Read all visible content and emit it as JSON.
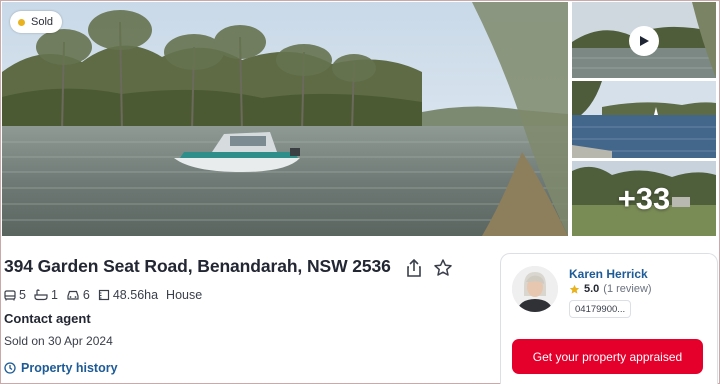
{
  "listing": {
    "status_badge": "Sold",
    "address": "394 Garden Seat Road, Benandarah, NSW 2536",
    "features": {
      "bedrooms": "5",
      "bathrooms": "1",
      "parking": "6",
      "land_size": "48.56ha",
      "property_type": "House"
    },
    "price": "Contact agent",
    "sold_date": "Sold on 30 Apr 2024",
    "property_history_label": "Property history"
  },
  "gallery": {
    "extra_photos_count": "+33",
    "icons": [
      "play-icon"
    ]
  },
  "agent": {
    "name": "Karen Herrick",
    "rating": "5.0",
    "reviews": "(1 review)",
    "phone": "04179900...",
    "cta_label": "Get your property appraised"
  },
  "colors": {
    "accent_red": "#e4002b",
    "link_blue": "#1d5b96",
    "sold_dot": "#e9b21f",
    "star": "#e9b21f"
  }
}
